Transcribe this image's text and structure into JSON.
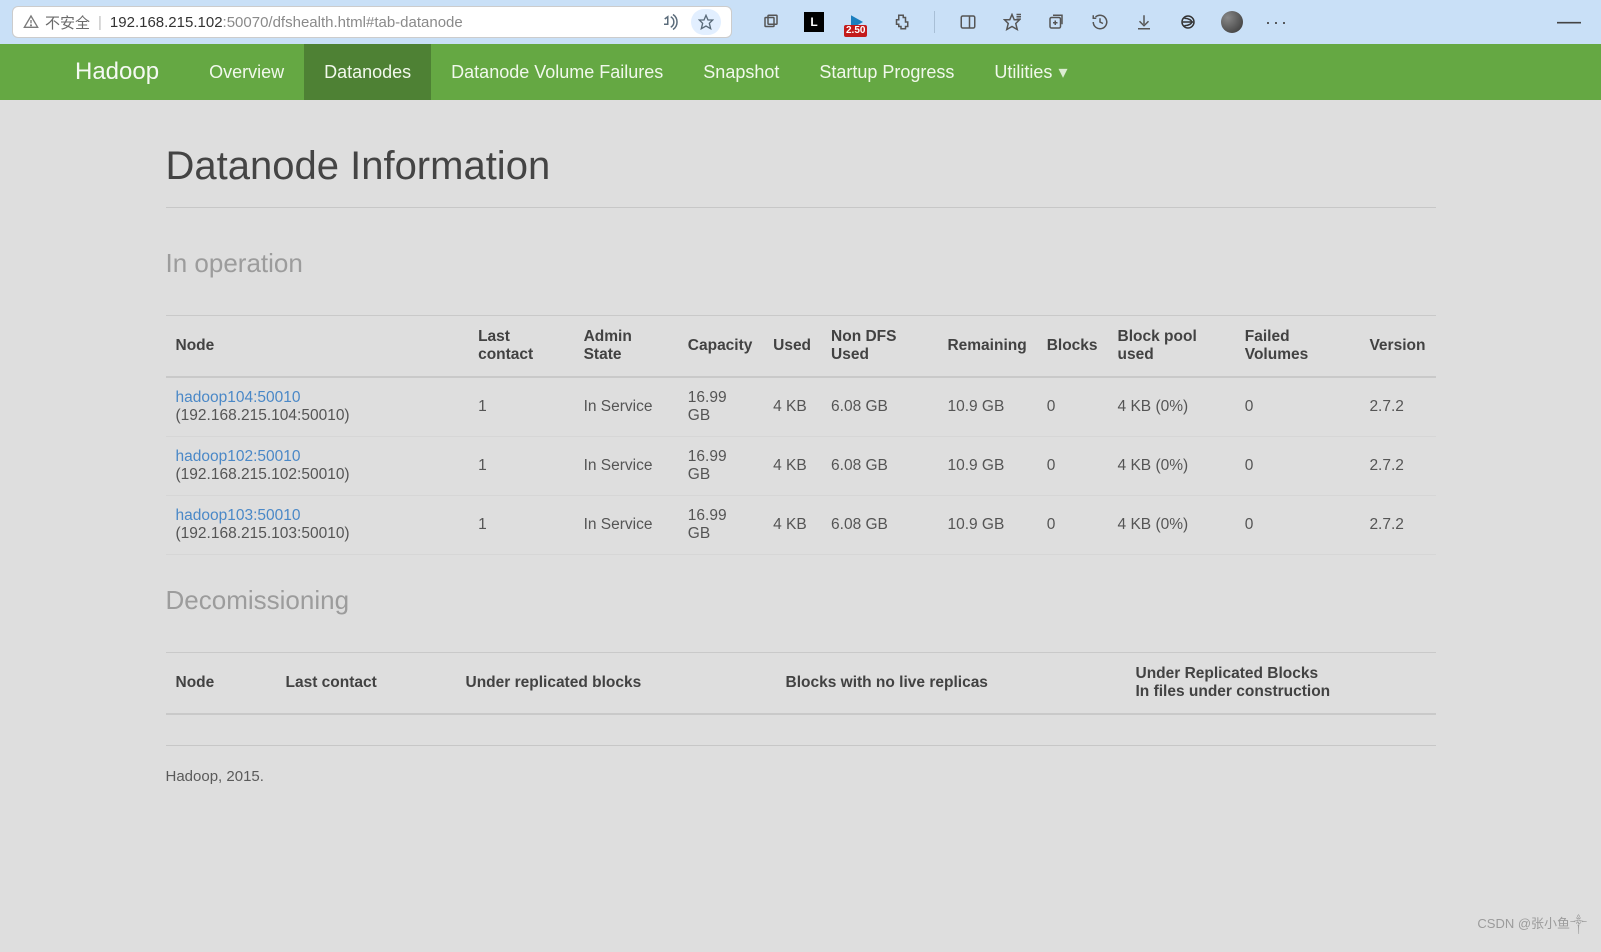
{
  "browser": {
    "not_secure_label": "不安全",
    "url_main": "192.168.215.102",
    "url_rest": ":50070/dfshealth.html#tab-datanode",
    "idm_badge": "2.50"
  },
  "nav": {
    "brand": "Hadoop",
    "items": [
      {
        "label": "Overview",
        "active": false
      },
      {
        "label": "Datanodes",
        "active": true
      },
      {
        "label": "Datanode Volume Failures",
        "active": false
      },
      {
        "label": "Snapshot",
        "active": false
      },
      {
        "label": "Startup Progress",
        "active": false
      },
      {
        "label": "Utilities",
        "active": false,
        "dropdown": true
      }
    ]
  },
  "page": {
    "title": "Datanode Information",
    "in_operation": {
      "heading": "In operation",
      "columns": [
        "Node",
        "Last contact",
        "Admin State",
        "Capacity",
        "Used",
        "Non DFS Used",
        "Remaining",
        "Blocks",
        "Block pool used",
        "Failed Volumes",
        "Version"
      ],
      "rows": [
        {
          "node_link": "hadoop104:50010",
          "node_addr": " (192.168.215.104:50010)",
          "last_contact": "1",
          "admin_state": "In Service",
          "capacity": "16.99 GB",
          "used": "4 KB",
          "non_dfs_used": "6.08 GB",
          "remaining": "10.9 GB",
          "blocks": "0",
          "block_pool_used": "4 KB (0%)",
          "failed_volumes": "0",
          "version": "2.7.2"
        },
        {
          "node_link": "hadoop102:50010",
          "node_addr": " (192.168.215.102:50010)",
          "last_contact": "1",
          "admin_state": "In Service",
          "capacity": "16.99 GB",
          "used": "4 KB",
          "non_dfs_used": "6.08 GB",
          "remaining": "10.9 GB",
          "blocks": "0",
          "block_pool_used": "4 KB (0%)",
          "failed_volumes": "0",
          "version": "2.7.2"
        },
        {
          "node_link": "hadoop103:50010",
          "node_addr": " (192.168.215.103:50010)",
          "last_contact": "1",
          "admin_state": "In Service",
          "capacity": "16.99 GB",
          "used": "4 KB",
          "non_dfs_used": "6.08 GB",
          "remaining": "10.9 GB",
          "blocks": "0",
          "block_pool_used": "4 KB (0%)",
          "failed_volumes": "0",
          "version": "2.7.2"
        }
      ]
    },
    "decomissioning": {
      "heading": "Decomissioning",
      "columns_flat": [
        "Node",
        "Last contact",
        "Under replicated blocks",
        "Blocks with no live replicas"
      ],
      "col_multi_line1": "Under Replicated Blocks",
      "col_multi_line2": "In files under construction"
    },
    "footer": "Hadoop, 2015."
  },
  "watermark": "CSDN @张小鱼༒"
}
